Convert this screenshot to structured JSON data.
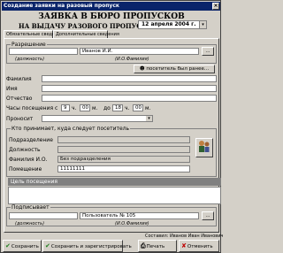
{
  "window": {
    "title": "Создание заявки на разовый пропуск",
    "close": "×"
  },
  "header": {
    "title": "ЗАЯВКА В БЮРО ПРОПУСКОВ",
    "subtitle": "НА ВЫДАЧУ РАЗОВОГО ПРОПУСКА на",
    "date": "12 апреля 2004 г.",
    "date_dropdown": "▾"
  },
  "tabs": [
    "Обязательные сведения",
    "Дополнительные сведения"
  ],
  "permission": {
    "group_title": "Разрешение",
    "position_label": "(должность)",
    "name_value": "Иванов И.И.",
    "name_caption": "(И.О.Фамилия)",
    "browse": "..."
  },
  "visited_before_button": "посетитель был ранее...",
  "visitor": {
    "surname_label": "Фамилия",
    "name_label": "Имя",
    "patronymic_label": "Отчество"
  },
  "hours": {
    "label": "Часы посещения с",
    "from_h": "9",
    "from_h_unit": "ч.",
    "from_m": "00",
    "from_m_unit": "м.",
    "to_label": "до",
    "to_h": "18",
    "to_h_unit": "ч.",
    "to_m": "00",
    "to_m_unit": "м."
  },
  "pass_label": "Проносит",
  "who_receives": {
    "group_title": "Кто принимает, куда следует посетитель",
    "department_label": "Подразделение",
    "position_label": "Должность",
    "fio_label": "Фамилия И.О.",
    "fio_value": "Без подразделения",
    "room_label": "Помещение",
    "room_value": "11111111"
  },
  "purpose": {
    "label": "Цель посещения"
  },
  "signer": {
    "group_title": "Подписывает",
    "position_label": "(должность)",
    "name_value": "Пользователь № 105",
    "name_caption": "(И.О.Фамилия)",
    "browse": "..."
  },
  "status": {
    "label": "Составил:",
    "value": "Иванов Иван Иванович"
  },
  "buttons": {
    "save": "Сохранить",
    "save_register": "Сохранить и зарегистрировать",
    "print": "Печать",
    "cancel": "Отменить"
  }
}
